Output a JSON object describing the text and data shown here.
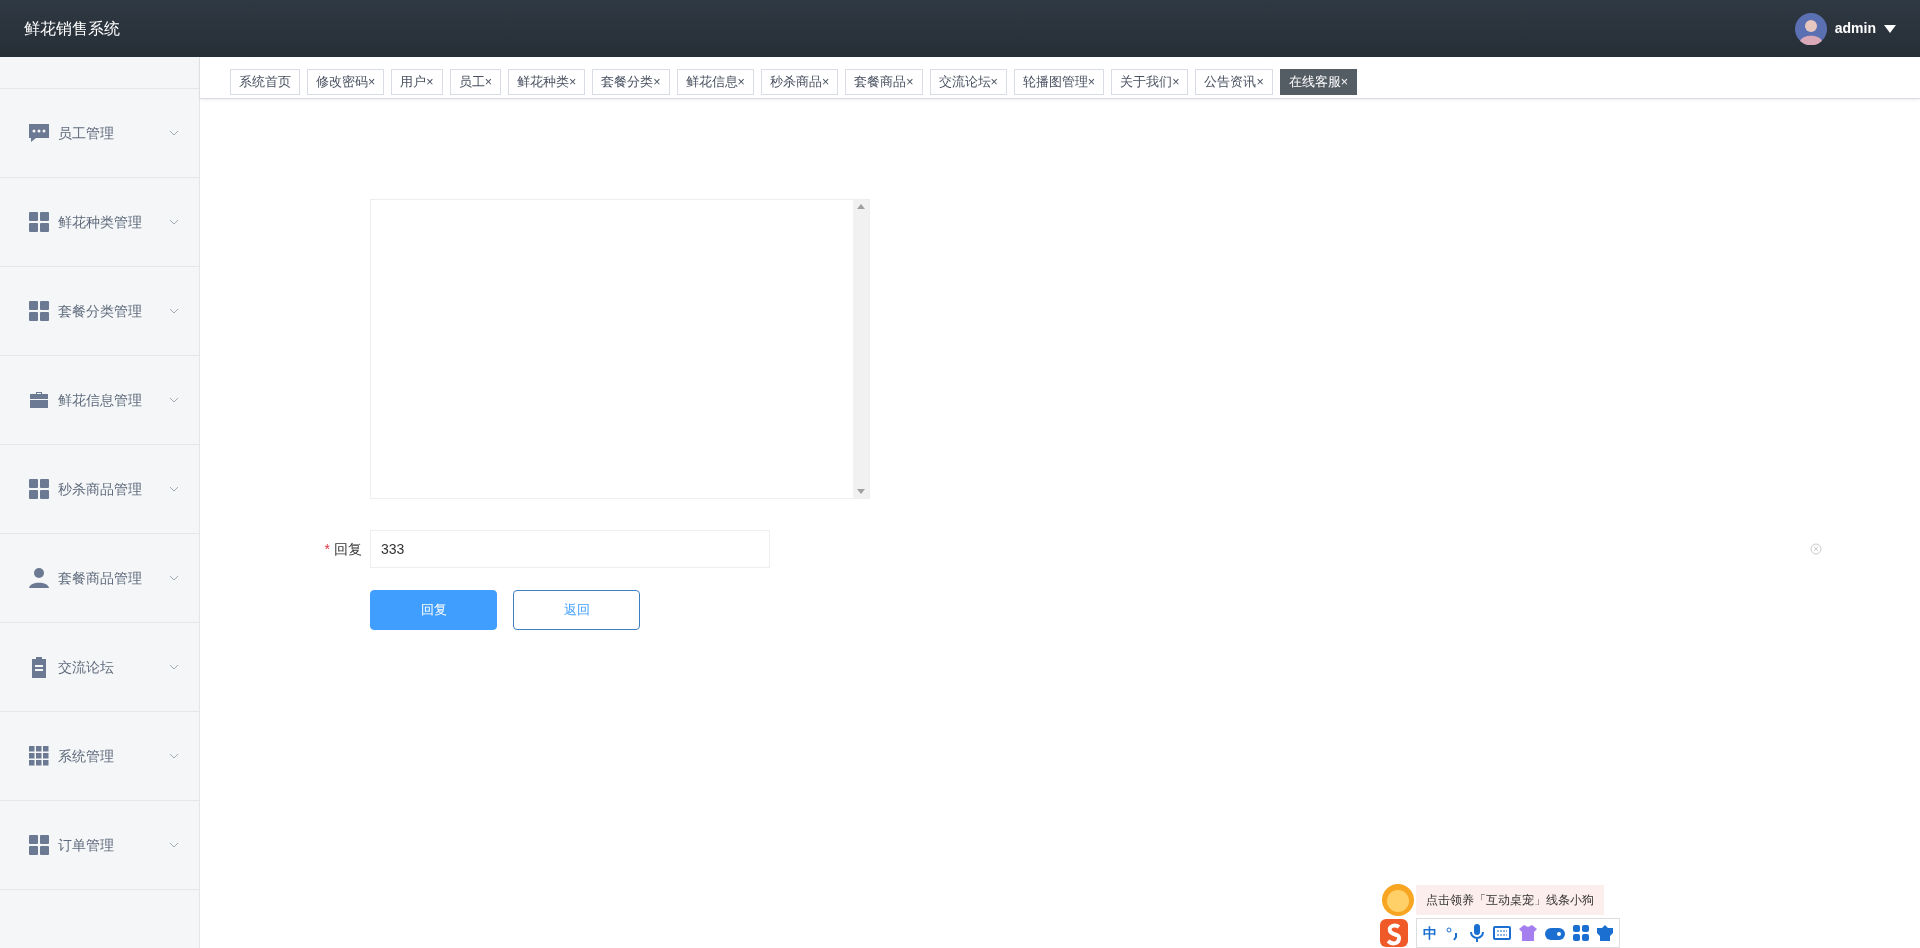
{
  "header": {
    "title": "鲜花销售系统",
    "user": "admin"
  },
  "sidebar": {
    "items": [
      {
        "kind": "chat",
        "label": "员工管理"
      },
      {
        "kind": "grid",
        "label": "鲜花种类管理"
      },
      {
        "kind": "grid",
        "label": "套餐分类管理"
      },
      {
        "kind": "briefcase",
        "label": "鲜花信息管理"
      },
      {
        "kind": "grid",
        "label": "秒杀商品管理"
      },
      {
        "kind": "user",
        "label": "套餐商品管理"
      },
      {
        "kind": "clipboard",
        "label": "交流论坛"
      },
      {
        "kind": "grid9",
        "label": "系统管理"
      },
      {
        "kind": "grid",
        "label": "订单管理"
      }
    ]
  },
  "tabs": [
    {
      "label": "系统首页",
      "selected": false
    },
    {
      "label": "修改密码",
      "close": "×",
      "selected": false
    },
    {
      "label": "用户",
      "close": "×",
      "selected": false
    },
    {
      "label": "员工",
      "close": "×",
      "selected": false
    },
    {
      "label": "鲜花种类",
      "close": "×",
      "selected": false
    },
    {
      "label": "套餐分类",
      "close": "×",
      "selected": false
    },
    {
      "label": "鲜花信息",
      "close": "×",
      "selected": false
    },
    {
      "label": "秒杀商品",
      "close": "×",
      "selected": false
    },
    {
      "label": "套餐商品",
      "close": "×",
      "selected": false
    },
    {
      "label": "交流论坛",
      "close": "×",
      "selected": false
    },
    {
      "label": "轮播图管理",
      "close": "×",
      "selected": false
    },
    {
      "label": "关于我们",
      "close": "×",
      "selected": false
    },
    {
      "label": "公告资讯",
      "close": "×",
      "selected": false
    },
    {
      "label": "在线客服",
      "close": "×",
      "selected": true
    }
  ],
  "form": {
    "reply": {
      "required_mark": "*",
      "label": "回复",
      "value": "333"
    },
    "buttons": [
      {
        "kind": "primary",
        "label": "回复"
      },
      {
        "kind": "outline",
        "label": "返回"
      }
    ]
  },
  "ime": {
    "tip": "点击领养「互动桌宠」线条小狗",
    "mode": "中"
  }
}
